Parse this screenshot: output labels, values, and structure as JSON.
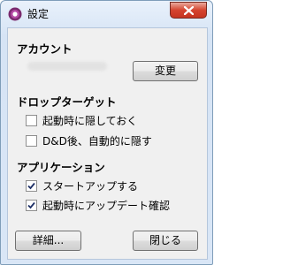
{
  "window": {
    "title": "設定"
  },
  "account": {
    "heading": "アカウント",
    "change_button": "変更"
  },
  "drop_target": {
    "heading": "ドロップターゲット",
    "options": [
      {
        "label": "起動時に隠しておく",
        "checked": false
      },
      {
        "label": "D&D後、自動的に隠す",
        "checked": false
      }
    ]
  },
  "application": {
    "heading": "アプリケーション",
    "options": [
      {
        "label": "スタートアップする",
        "checked": true
      },
      {
        "label": "起動時にアップデート確認",
        "checked": true
      }
    ]
  },
  "footer": {
    "details_button": "詳細...",
    "close_button": "閉じる"
  },
  "icons": {
    "app": "app-logo-icon",
    "close": "close-icon",
    "check": "check-icon"
  },
  "colors": {
    "close_button": "#c53420",
    "window_frame": "#d6e4f5",
    "client_bg": "#f0f0f0"
  }
}
